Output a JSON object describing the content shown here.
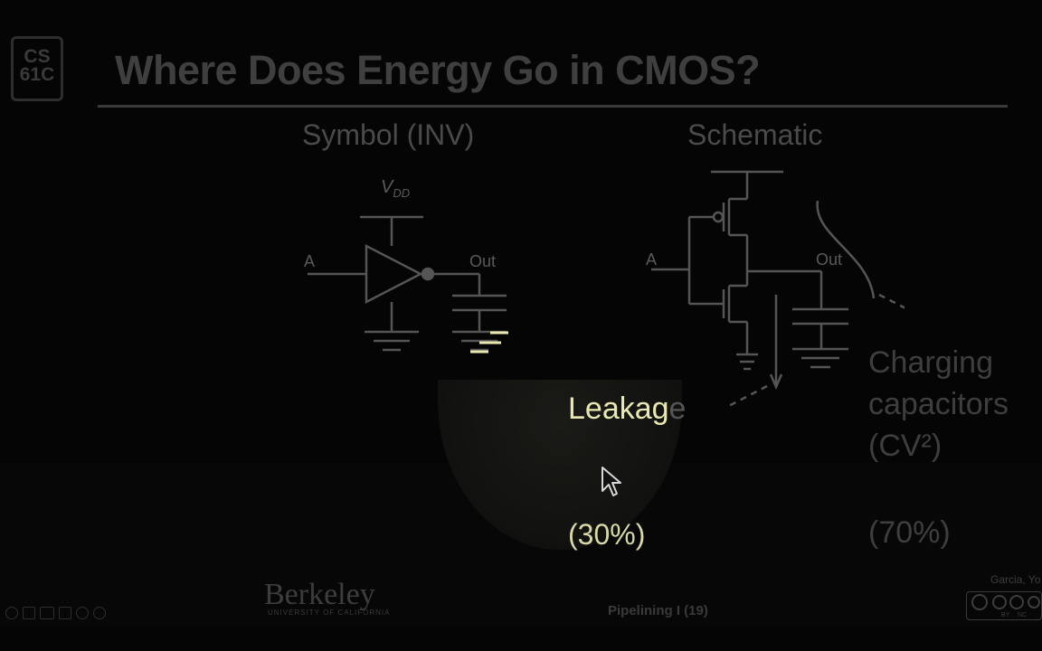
{
  "slide": {
    "logo_line1": "CS",
    "logo_line2": "61C",
    "title": "Where Does Energy Go in CMOS?",
    "symbol_heading": "Symbol (INV)",
    "schematic_heading": "Schematic",
    "vdd_label": "V",
    "vdd_sub": "DD",
    "symbol_in_label": "A",
    "symbol_out_label": "Out",
    "schem_in_label": "A",
    "schem_out_label": "Out",
    "leakage_bright": "Leakag",
    "leakage_dim": "e",
    "charging_line1": "Charging",
    "charging_line2": "capacitors",
    "charging_line3": "(CV²)",
    "pct_leakage": "(30%)",
    "pct_charging": "(70%)"
  },
  "footer": {
    "university": "Berkeley",
    "university_sub": "UNIVERSITY OF CALIFORNIA",
    "page_label": "Pipelining I (19)",
    "author": "Garcia, Yo",
    "license_by": "BY",
    "license_nc": "NC"
  },
  "colors": {
    "background": "#050505",
    "highlight": "#e8e8b0",
    "wire": "#555555"
  },
  "icons": [
    "pointer-icon",
    "pen-icon",
    "slides-icon",
    "fullscreen-icon",
    "menu-icon",
    "next-icon",
    "mouse-cursor-icon"
  ]
}
